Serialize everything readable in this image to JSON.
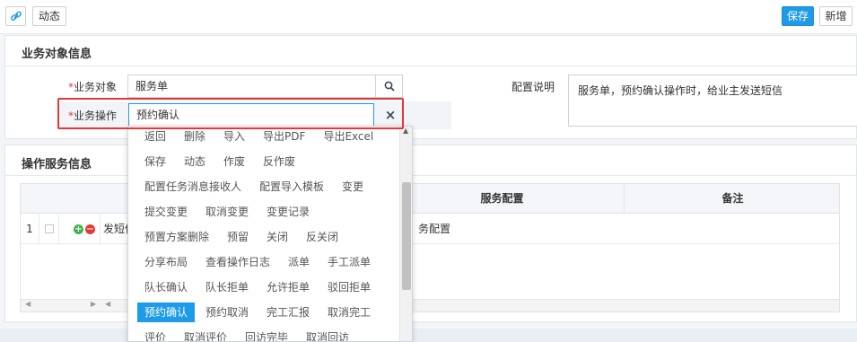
{
  "toolbar": {
    "dynamic_label": "动态",
    "save_label": "保存",
    "add_label": "新增"
  },
  "object_panel": {
    "title": "业务对象信息",
    "business_object": {
      "required": "*",
      "label": "业务对象",
      "value": "服务单"
    },
    "business_operation": {
      "required": "*",
      "label": "业务操作",
      "value": "预约确认"
    },
    "config_note": {
      "label": "配置说明",
      "value": "服务单，预约确认操作时，给业主发送短信"
    }
  },
  "service_panel": {
    "title": "操作服务信息",
    "columns": {
      "service_config": "服务配置",
      "remark": "备注"
    },
    "rows": [
      {
        "index": "1",
        "name_partial": "发短信",
        "config_partial": "务配置"
      }
    ]
  },
  "dropdown": {
    "rows": [
      [
        "返回",
        "删除",
        "导入",
        "导出PDF",
        "导出Excel"
      ],
      [
        "保存",
        "动态",
        "作废",
        "反作废"
      ],
      [
        "配置任务消息接收人",
        "配置导入模板",
        "变更"
      ],
      [
        "提交变更",
        "取消变更",
        "变更记录"
      ],
      [
        "预置方案删除",
        "预留",
        "关闭",
        "反关闭"
      ],
      [
        "分享布局",
        "查看操作日志",
        "派单",
        "手工派单"
      ],
      [
        "队长确认",
        "队长拒单",
        "允许拒单",
        "驳回拒单"
      ],
      [
        "预约确认",
        "预约取消",
        "完工汇报",
        "取消完工"
      ],
      [
        "评价",
        "取消评价",
        "回访完毕",
        "取消回访"
      ]
    ],
    "selected": "预约确认"
  },
  "colors": {
    "accent": "#1e9be8",
    "highlight": "#e53935"
  }
}
